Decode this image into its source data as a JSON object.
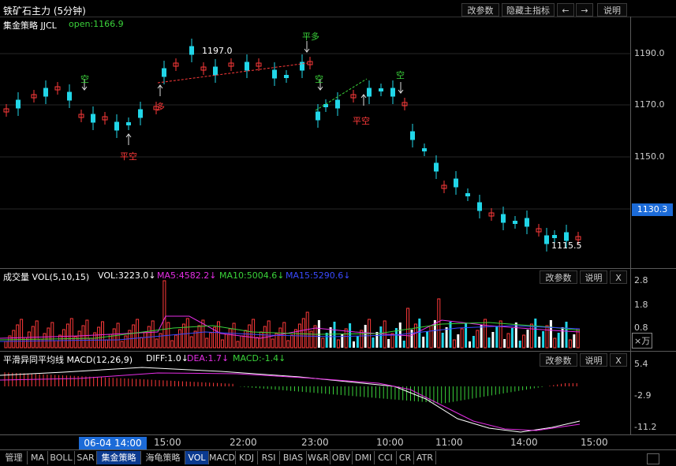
{
  "window": {
    "title": "铁矿石主力 (5分钟)"
  },
  "top_buttons": {
    "params": "改参数",
    "hide_indicator": "隐藏主指标",
    "back": "←",
    "forward": "→",
    "help": "说明"
  },
  "main": {
    "strategy_name": "集金策略 JJCL",
    "open_label": "open:1166.9",
    "y_labels": [
      "1190.0",
      "1170.0",
      "1150.0"
    ],
    "current_price": "1130.3",
    "high_marker": "1197.0",
    "low_marker": "1115.5",
    "signals": {
      "kong": "空",
      "pingkong": "平空",
      "duo": "多",
      "pingduo": "平多"
    },
    "colors": {
      "up": "#ff3a3a",
      "down": "#21d6e8",
      "signal_green": "#3ad23a",
      "signal_red": "#ff3a3a"
    }
  },
  "volume": {
    "label": "成交量 VOL(5,10,15)",
    "vol": "VOL:3223.0↓",
    "ma5": "MA5:4582.2↓",
    "ma10": "MA10:5004.6↓",
    "ma15": "MA15:5290.6↓",
    "params": "改参数",
    "help": "说明",
    "close": "X",
    "y_labels": [
      "2.8",
      "1.8",
      "0.8"
    ],
    "unit": "×万"
  },
  "macd": {
    "label": "平滑异同平均线 MACD(12,26,9)",
    "diff": "DIFF:1.0↓",
    "dea": "DEA:1.7↓",
    "macd": "MACD:-1.4↓",
    "params": "改参数",
    "help": "说明",
    "close": "X",
    "y_labels": [
      "5.4",
      "-2.9",
      "-11.2"
    ]
  },
  "x_axis": {
    "cursor": "06-04 14:00",
    "labels": [
      "15:00",
      "22:00",
      "23:00",
      "10:00",
      "11:00",
      "14:00",
      "15:00"
    ]
  },
  "tabs": [
    "管理",
    "MA",
    "BOLL",
    "SAR",
    "集金策略",
    "海龟策略",
    "VOL",
    "MACD",
    "KDJ",
    "RSI",
    "BIAS",
    "W&R",
    "OBV",
    "DMI",
    "CCI",
    "CR",
    "ATR"
  ],
  "active_tabs": [
    "集金策略",
    "VOL"
  ]
}
